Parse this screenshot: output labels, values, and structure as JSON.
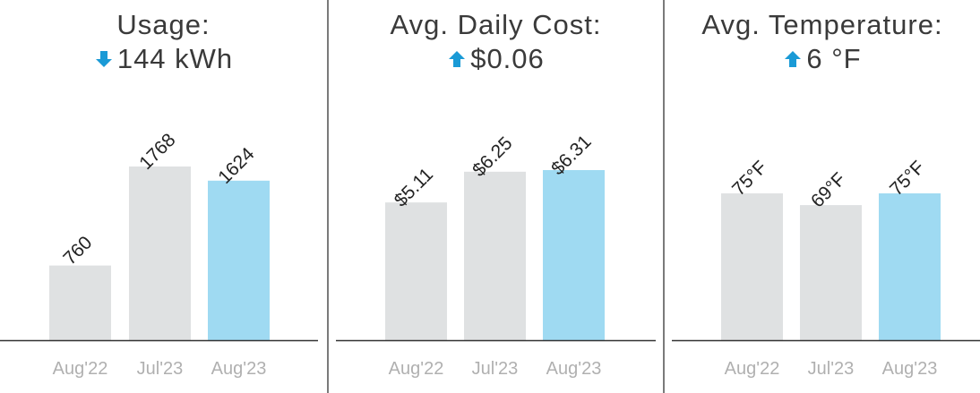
{
  "colors": {
    "past": "#dfe1e2",
    "current": "#9fdaf2",
    "arrow": "#1a9ad6",
    "axis": "#333333"
  },
  "panels": [
    {
      "title": "Usage:",
      "delta": {
        "direction": "down",
        "text": "144 kWh",
        "icon": "arrow-down-icon"
      },
      "chart_data": {
        "type": "bar",
        "categories": [
          "Aug'22",
          "Jul'23",
          "Aug'23"
        ],
        "values": [
          760,
          1768,
          1624
        ],
        "labels": [
          "760",
          "1768",
          "1624"
        ],
        "highlight_index": 2,
        "ylim": [
          0,
          1768
        ]
      }
    },
    {
      "title": "Avg. Daily Cost:",
      "delta": {
        "direction": "up",
        "text": "$0.06",
        "icon": "arrow-up-icon"
      },
      "chart_data": {
        "type": "bar",
        "categories": [
          "Aug'22",
          "Jul'23",
          "Aug'23"
        ],
        "values": [
          5.11,
          6.25,
          6.31
        ],
        "labels": [
          "$5.11",
          "$6.25",
          "$6.31"
        ],
        "highlight_index": 2,
        "ylim": [
          0,
          6.31
        ]
      }
    },
    {
      "title": "Avg. Temperature:",
      "delta": {
        "direction": "up",
        "text": "6 °F",
        "icon": "arrow-up-icon"
      },
      "chart_data": {
        "type": "bar",
        "categories": [
          "Aug'22",
          "Jul'23",
          "Aug'23"
        ],
        "values": [
          75,
          69,
          75
        ],
        "labels": [
          "75°F",
          "69°F",
          "75°F"
        ],
        "highlight_index": 2,
        "ylim": [
          0,
          75
        ]
      }
    }
  ]
}
